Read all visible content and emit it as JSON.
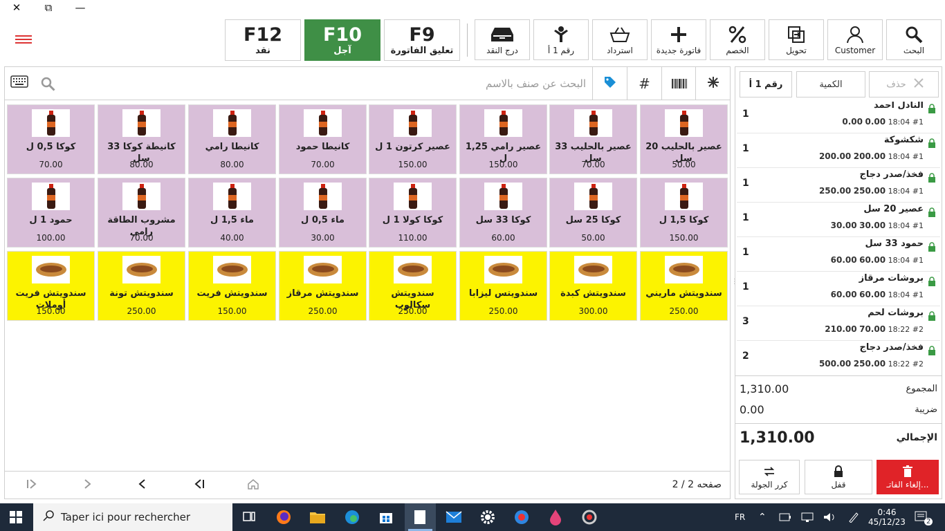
{
  "window": {
    "close_glyph": "✕",
    "restore_glyph": "⧉",
    "minimize_glyph": "—"
  },
  "toolbar": {
    "fkeys": [
      {
        "key": "F12",
        "label": "نقد"
      },
      {
        "key": "F10",
        "label": "آجل",
        "active": true
      },
      {
        "key": "F9",
        "label": "تعليق الفاتورة"
      }
    ],
    "buttons": [
      {
        "label": "درج النقد",
        "icon": "cash-drawer-icon"
      },
      {
        "label": "رقم 1 أ",
        "icon": "customer-seat-icon"
      },
      {
        "label": "استرداد",
        "icon": "refund-icon"
      },
      {
        "label": "فاتورة جديدة",
        "icon": "plus-icon"
      },
      {
        "label": "الخصم",
        "icon": "percent-icon"
      },
      {
        "label": "تحويل",
        "icon": "transfer-icon"
      },
      {
        "label": "Customer",
        "icon": "customer-icon"
      },
      {
        "label": "البحث",
        "icon": "search-icon"
      }
    ]
  },
  "search": {
    "placeholder": "البحث عن صنف بالاسم"
  },
  "products": [
    {
      "name": "كوكا 0,5 ل",
      "price": "70.00",
      "cat": "drink"
    },
    {
      "name": "كانيطة كوكا 33 سل",
      "price": "80.00",
      "cat": "drink"
    },
    {
      "name": "كانيطا رامي",
      "price": "80.00",
      "cat": "drink"
    },
    {
      "name": "كانيطا حمود",
      "price": "70.00",
      "cat": "drink"
    },
    {
      "name": "عصير كرتون 1 ل",
      "price": "150.00",
      "cat": "drink"
    },
    {
      "name": "عصير رامي 1,25 ل",
      "price": "150.00",
      "cat": "drink"
    },
    {
      "name": "عصير بالحليب 33 سل",
      "price": "70.00",
      "cat": "drink"
    },
    {
      "name": "عصير بالحليب 20 سل",
      "price": "50.00",
      "cat": "drink"
    },
    {
      "name": "حمود 1 ل",
      "price": "100.00",
      "cat": "drink"
    },
    {
      "name": "مشروب الطاقة رامي",
      "price": "70.00",
      "cat": "drink"
    },
    {
      "name": "ماء 1,5 ل",
      "price": "40.00",
      "cat": "drink"
    },
    {
      "name": "ماء 0,5 ل",
      "price": "30.00",
      "cat": "drink"
    },
    {
      "name": "كوكا كولا 1 ل",
      "price": "110.00",
      "cat": "drink"
    },
    {
      "name": "كوكا 33 سل",
      "price": "60.00",
      "cat": "drink"
    },
    {
      "name": "كوكا 25 سل",
      "price": "50.00",
      "cat": "drink"
    },
    {
      "name": "كوكا 1,5 ل",
      "price": "150.00",
      "cat": "drink"
    },
    {
      "name": "سندويتش فريت أوملات",
      "price": "150.00",
      "cat": "sand"
    },
    {
      "name": "سندويتش تونة",
      "price": "250.00",
      "cat": "sand"
    },
    {
      "name": "سندويتش فريت",
      "price": "150.00",
      "cat": "sand"
    },
    {
      "name": "سندويتش مرقاز",
      "price": "250.00",
      "cat": "sand"
    },
    {
      "name": "سندويتش سكالوب",
      "price": "250.00",
      "cat": "sand"
    },
    {
      "name": "سندويتس ليزابا",
      "price": "250.00",
      "cat": "sand"
    },
    {
      "name": "سندويتش كبدة",
      "price": "300.00",
      "cat": "sand"
    },
    {
      "name": "سندويتش ماريني",
      "price": "250.00",
      "cat": "sand"
    }
  ],
  "pager": {
    "info": "صفحه 2 / 2"
  },
  "order_panel": {
    "delete_label": "حذف",
    "quantity_label": "الكمية",
    "seat_label": "رقم 1 أ",
    "items": [
      {
        "qty": "1",
        "name": "النادل احمد",
        "seat": "#1",
        "time": "18:04",
        "unit": "0.00",
        "total": "0.00"
      },
      {
        "qty": "1",
        "name": "شكشوكة",
        "seat": "#1",
        "time": "18:04",
        "unit": "200.00",
        "total": "200.00"
      },
      {
        "qty": "1",
        "name": "فخذ/صدر  دجاج",
        "seat": "#1",
        "time": "18:04",
        "unit": "250.00",
        "total": "250.00"
      },
      {
        "qty": "1",
        "name": "عصير 20 سل",
        "seat": "#1",
        "time": "18:04",
        "unit": "30.00",
        "total": "30.00"
      },
      {
        "qty": "1",
        "name": "حمود 33 سل",
        "seat": "#1",
        "time": "18:04",
        "unit": "60.00",
        "total": "60.00"
      },
      {
        "qty": "1",
        "name": "بروشات مرقاز",
        "seat": "#1",
        "time": "18:04",
        "unit": "60.00",
        "total": "60.00"
      },
      {
        "qty": "3",
        "name": "بروشات لحم",
        "seat": "#2",
        "time": "18:22",
        "unit": "70.00",
        "total": "210.00"
      },
      {
        "qty": "2",
        "name": "فخذ/صدر  دجاج",
        "seat": "#2",
        "time": "18:22",
        "unit": "250.00",
        "total": "500.00"
      }
    ],
    "subtotal_label": "المجموع",
    "subtotal": "1,310.00",
    "tax_label": "ضريبة",
    "tax": "0.00",
    "grand_label": "الإجمالي",
    "grand": "1,310.00",
    "repeat_label": "كرر الجولة",
    "lock_label": "قفل",
    "cancel_label": "إلغاء الفاتـ..."
  },
  "taskbar": {
    "search_placeholder": "Taper ici pour rechercher",
    "lang": "FR",
    "time": "0:46",
    "date": "45/12/23",
    "notif_count": "2"
  }
}
